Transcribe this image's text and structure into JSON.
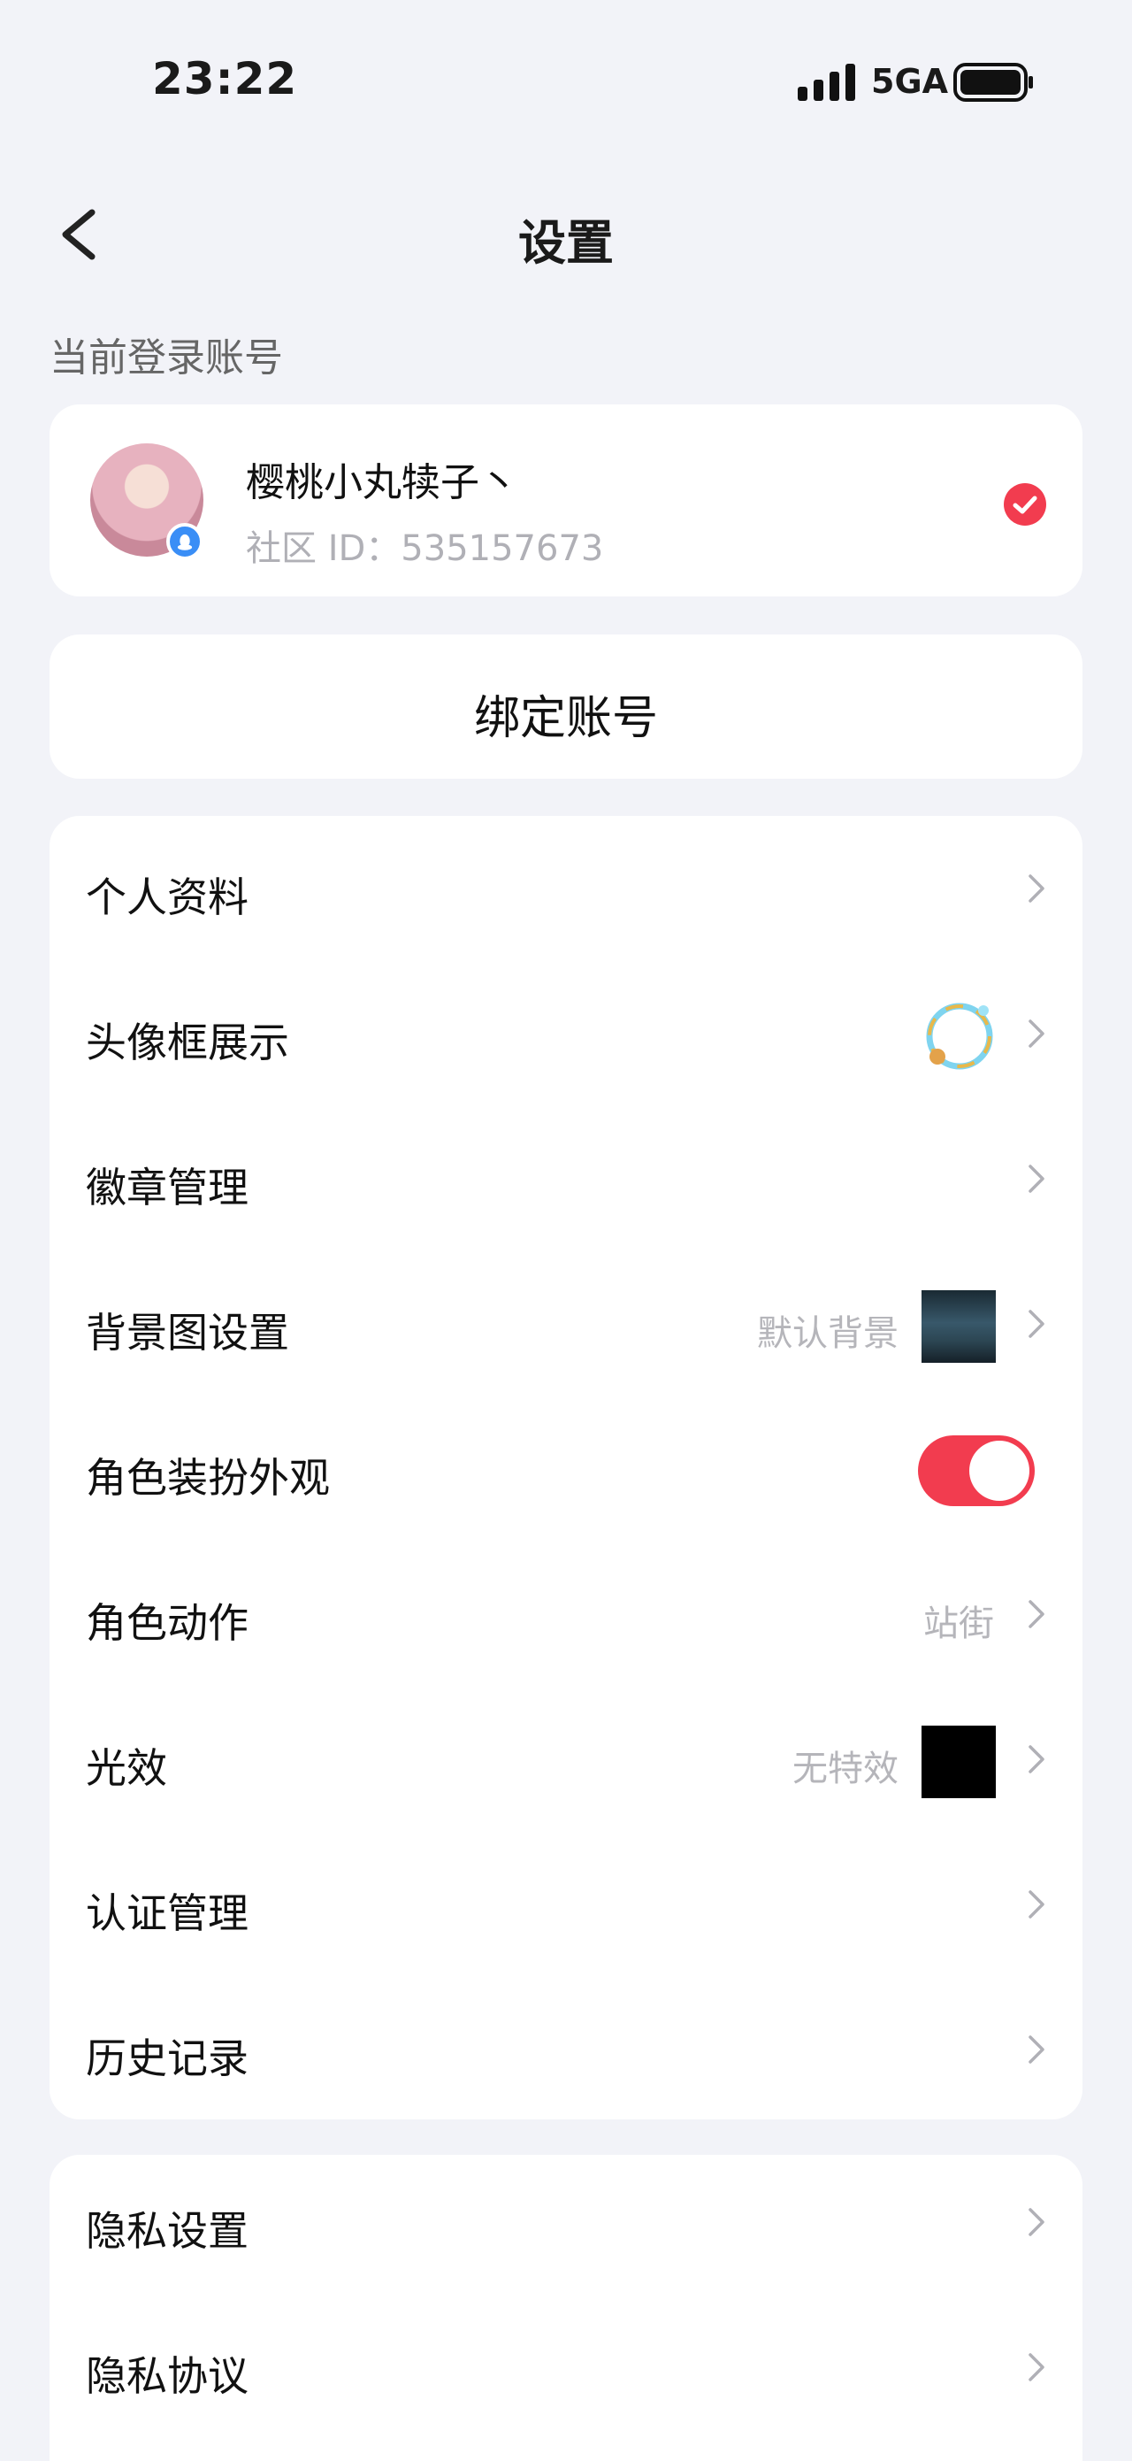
{
  "status_bar": {
    "time": "23:22",
    "network": "5GA"
  },
  "header": {
    "title": "设置"
  },
  "account_section": {
    "label": "当前登录账号",
    "username": "樱桃小丸犊子丶",
    "community_id": "社区 ID：535157673"
  },
  "bind_account": {
    "label": "绑定账号"
  },
  "settings_list": [
    {
      "label": "个人资料"
    },
    {
      "label": "头像框展示"
    },
    {
      "label": "徽章管理"
    },
    {
      "label": "背景图设置",
      "value": "默认背景"
    },
    {
      "label": "角色装扮外观",
      "toggle": true
    },
    {
      "label": "角色动作",
      "value": "站街"
    },
    {
      "label": "光效",
      "value": "无特效"
    },
    {
      "label": "认证管理"
    },
    {
      "label": "历史记录"
    }
  ],
  "privacy_list": [
    {
      "label": "隐私设置"
    },
    {
      "label": "隐私协议"
    }
  ],
  "colors": {
    "accent": "#f23c4f",
    "background": "#f2f3f8",
    "card": "#ffffff",
    "secondary_text": "#b5b5ba"
  }
}
